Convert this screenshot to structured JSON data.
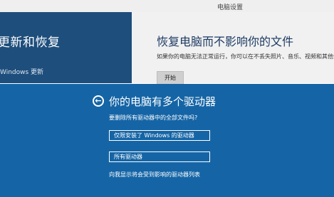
{
  "window": {
    "title": "电脑设置"
  },
  "sidebar": {
    "heading": "更新和恢复",
    "item": "Windows 更新"
  },
  "main": {
    "heading": "恢复电脑而不影响你的文件",
    "description": "如果你的电脑无法正常运行，你可以在不丢失照片、音乐、视频和其他个人文件的情况下对其进行恢复。",
    "start_button": "开始"
  },
  "dialog": {
    "heading": "你的电脑有多个驱动器",
    "question": "要删除所有驱动器中的全部文件吗?",
    "option_windows_drive": "仅限安装了 Windows 的驱动器",
    "option_all_drives": "所有驱动器",
    "show_drives_link": "向我显示将会受到影响的驱动器列表"
  },
  "colors": {
    "dialog_bg": "#1565a6",
    "sidebar_bg": "#1e4e7c"
  }
}
